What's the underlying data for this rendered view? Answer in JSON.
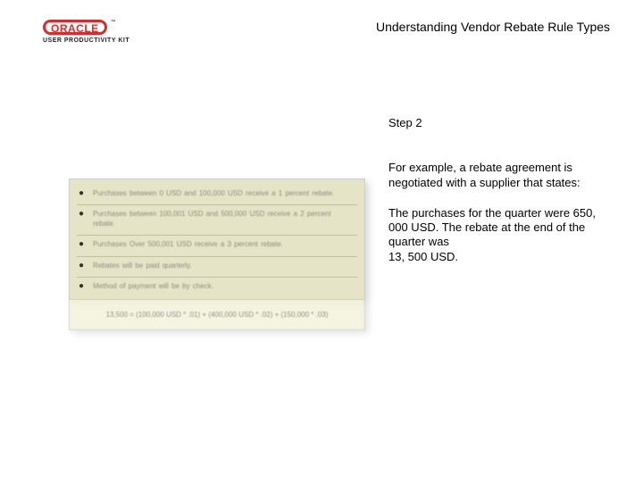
{
  "logo": {
    "brand": "ORACLE",
    "tm": "™",
    "subtitle": "USER PRODUCTIVITY KIT"
  },
  "title": "Understanding Vendor Rebate Rule Types",
  "step_label": "Step 2",
  "para1": "For example, a rebate agreement is negotiated with a supplier that states:",
  "para2": "The purchases for the quarter were 650, 000 USD. The rebate at the end of the quarter was",
  "para2_amount": "13, 500 USD.",
  "panel": {
    "items": [
      "Purchases between 0 USD and 100,000 USD receive a 1 percent rebate.",
      "Purchases between 100,001 USD and 500,000 USD receive a 2 percent rebate.",
      "Purchases Over 500,001 USD receive a 3 percent rebate.",
      "Rebates will be paid quarterly.",
      "Method of payment will be by check."
    ],
    "formula": "13,500 = (100,000 USD * .01) + (400,000 USD * .02) + (150,000 * .03)"
  }
}
